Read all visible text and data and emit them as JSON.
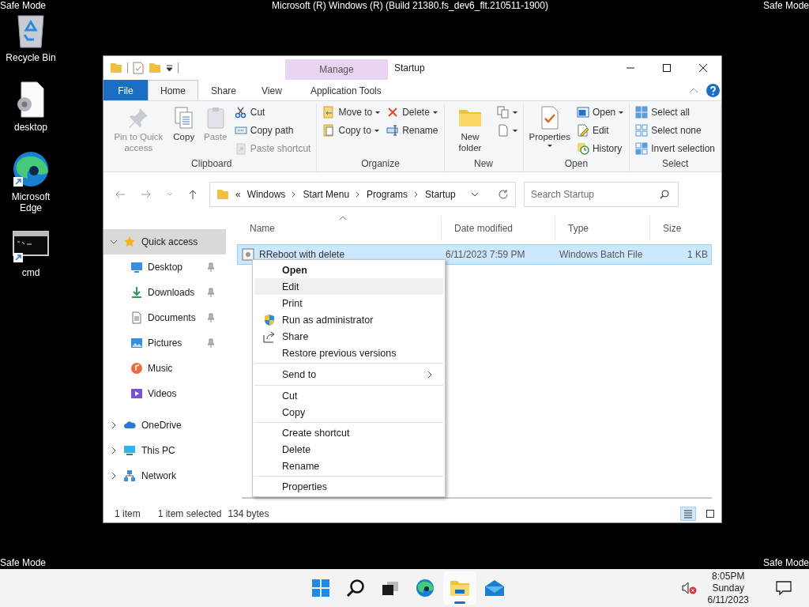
{
  "desktop": {
    "safe_mode_labels": [
      "Safe Mode",
      "Safe Mode",
      "Safe Mode",
      "Safe Mode"
    ],
    "build_text": "Microsoft (R) Windows (R) (Build 21380.fs_dev6_flt.210511-1900)",
    "icons": [
      {
        "label": "Recycle Bin",
        "kind": "recycle"
      },
      {
        "label": "desktop",
        "kind": "settings-file"
      },
      {
        "label": "Microsoft Edge",
        "kind": "browser"
      },
      {
        "label": "cmd",
        "kind": "console"
      }
    ]
  },
  "window": {
    "title": "Startup",
    "contextual_group": "Manage",
    "tabs": [
      {
        "label": "File",
        "kind": "file",
        "selected": false
      },
      {
        "label": "Home",
        "kind": "normal",
        "selected": true
      },
      {
        "label": "Share",
        "kind": "normal",
        "selected": false
      },
      {
        "label": "View",
        "kind": "normal",
        "selected": false
      },
      {
        "label": "Application Tools",
        "kind": "contextual",
        "selected": false
      }
    ],
    "ribbon": [
      {
        "label": "Clipboard",
        "items": [
          {
            "kind": "large",
            "label": "Pin to Quick access",
            "disabled": true,
            "dropdown": false
          },
          {
            "kind": "large",
            "label": "Copy",
            "disabled": false,
            "dropdown": false
          },
          {
            "kind": "large",
            "label": "Paste",
            "disabled": true,
            "dropdown": false
          },
          {
            "kind": "stack",
            "items": [
              {
                "label": "Cut",
                "disabled": false,
                "dropdown": false
              },
              {
                "label": "Copy path",
                "disabled": false,
                "dropdown": false
              },
              {
                "label": "Paste shortcut",
                "disabled": true,
                "dropdown": false
              }
            ]
          }
        ]
      },
      {
        "label": "Organize",
        "items": [
          {
            "kind": "stack",
            "items": [
              {
                "label": "Move to",
                "disabled": false,
                "dropdown": true
              },
              {
                "label": "Copy to",
                "disabled": false,
                "dropdown": true
              }
            ]
          },
          {
            "kind": "stack",
            "items": [
              {
                "label": "Delete",
                "disabled": false,
                "dropdown": true
              },
              {
                "label": "Rename",
                "disabled": false,
                "dropdown": false
              }
            ]
          }
        ]
      },
      {
        "label": "New",
        "items": [
          {
            "kind": "large",
            "label": "New folder",
            "disabled": false,
            "dropdown": false
          },
          {
            "kind": "stack",
            "items": [
              {
                "disabled": false,
                "dropdown": true
              },
              {
                "disabled": false,
                "dropdown": true
              }
            ]
          }
        ]
      },
      {
        "label": "Open",
        "items": [
          {
            "kind": "large",
            "label": "Properties",
            "disabled": false,
            "dropdown": true
          },
          {
            "kind": "stack",
            "items": [
              {
                "label": "Open",
                "disabled": false,
                "dropdown": true
              },
              {
                "label": "Edit",
                "disabled": false,
                "dropdown": false
              },
              {
                "label": "History",
                "disabled": false,
                "dropdown": false
              }
            ]
          }
        ]
      },
      {
        "label": "Select",
        "items": [
          {
            "kind": "stack",
            "items": [
              {
                "label": "Select all",
                "disabled": false,
                "dropdown": false
              },
              {
                "label": "Select none",
                "disabled": false,
                "dropdown": false
              },
              {
                "label": "Invert selection",
                "disabled": false,
                "dropdown": false
              }
            ]
          }
        ]
      }
    ],
    "address": {
      "overflow": "«",
      "crumbs": [
        "Windows",
        "Start Menu",
        "Programs",
        "Startup"
      ]
    },
    "search": {
      "placeholder": "Search Startup"
    },
    "navigation": [
      {
        "label": "Quick access",
        "kind": "star",
        "expanded": true,
        "selected": true,
        "children": [
          {
            "label": "Desktop",
            "kind": "desktop",
            "pinned": true,
            "selected": false
          },
          {
            "label": "Downloads",
            "kind": "downloads",
            "pinned": true,
            "selected": false
          },
          {
            "label": "Documents",
            "kind": "documents",
            "pinned": true,
            "selected": false
          },
          {
            "label": "Pictures",
            "kind": "pictures",
            "pinned": true,
            "selected": false
          },
          {
            "label": "Music",
            "kind": "music",
            "pinned": false,
            "selected": false
          },
          {
            "label": "Videos",
            "kind": "videos",
            "pinned": false,
            "selected": false
          }
        ]
      },
      {
        "label": "OneDrive",
        "kind": "cloud",
        "expanded": false,
        "selected": false
      },
      {
        "label": "This PC",
        "kind": "pc",
        "expanded": false,
        "selected": false
      },
      {
        "label": "Network",
        "kind": "network",
        "expanded": false,
        "selected": false
      }
    ],
    "columns": [
      "Name",
      "Date modified",
      "Type",
      "Size"
    ],
    "rows": [
      {
        "name": "RReboot with delete",
        "date": "6/11/2023 7:59 PM",
        "type": "Windows Batch File",
        "size": "1 KB",
        "selected": true
      }
    ],
    "context_menu": [
      [
        {
          "label": "Open",
          "kind": "default",
          "selected": false
        },
        {
          "label": "Edit",
          "kind": "plain",
          "selected": true
        },
        {
          "label": "Print",
          "kind": "plain",
          "selected": false
        },
        {
          "label": "Run as administrator",
          "kind": "admin",
          "selected": false
        },
        {
          "label": "Share",
          "kind": "share",
          "selected": false
        },
        {
          "label": "Restore previous versions",
          "kind": "plain",
          "selected": false
        }
      ],
      [
        {
          "label": "Send to",
          "kind": "submenu",
          "selected": false
        }
      ],
      [
        {
          "label": "Cut",
          "kind": "plain",
          "selected": false
        },
        {
          "label": "Copy",
          "kind": "plain",
          "selected": false
        }
      ],
      [
        {
          "label": "Create shortcut",
          "kind": "plain",
          "selected": false
        },
        {
          "label": "Delete",
          "kind": "plain",
          "selected": false
        },
        {
          "label": "Rename",
          "kind": "plain",
          "selected": false
        }
      ],
      [
        {
          "label": "Properties",
          "kind": "plain",
          "selected": false
        }
      ]
    ],
    "status_bar": {
      "item_count": "1 item",
      "selection": "1 item selected",
      "size": "134 bytes",
      "views": [
        {
          "kind": "details",
          "selected": true
        },
        {
          "kind": "large-icons",
          "selected": false
        }
      ]
    }
  },
  "taskbar": {
    "apps": [
      {
        "kind": "start",
        "active": false
      },
      {
        "kind": "search",
        "active": false
      },
      {
        "kind": "task-view",
        "active": false
      },
      {
        "kind": "browser",
        "active": false
      },
      {
        "kind": "explorer",
        "active": true
      },
      {
        "kind": "mail",
        "active": false
      }
    ],
    "tray": {
      "muted": true,
      "time": "8:05PM",
      "day": "Sunday",
      "date": "6/11/2023"
    }
  }
}
